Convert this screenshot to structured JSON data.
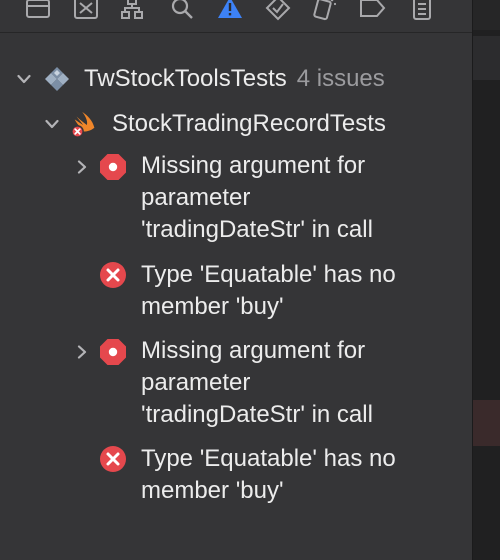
{
  "toolbar": {
    "icons": [
      "project-navigator-icon",
      "source-control-icon",
      "symbol-navigator-icon",
      "find-navigator-icon",
      "issue-navigator-icon",
      "test-navigator-icon",
      "debug-navigator-icon",
      "breakpoint-navigator-icon",
      "report-navigator-icon"
    ],
    "active_icon": "issue-navigator-icon",
    "active_color": "#3d82f6"
  },
  "tree": {
    "project": {
      "name": "TwStockToolsTests",
      "issue_count": "4 issues",
      "icon": "test-target-icon"
    },
    "file": {
      "name": "StockTradingRecordTests",
      "icon": "swift-file-error-icon"
    },
    "issues": [
      {
        "type": "error-octagon",
        "expandable": true,
        "lines": [
          "Missing argument for",
          "parameter",
          "'tradingDateStr' in call"
        ]
      },
      {
        "type": "error-circle",
        "expandable": false,
        "lines": [
          "Type 'Equatable' has no",
          "member 'buy'"
        ]
      },
      {
        "type": "error-octagon",
        "expandable": true,
        "lines": [
          "Missing argument for",
          "parameter",
          "'tradingDateStr' in call"
        ]
      },
      {
        "type": "error-circle",
        "expandable": false,
        "lines": [
          "Type 'Equatable' has no",
          "member 'buy'"
        ]
      }
    ]
  },
  "colors": {
    "error_red": "#e5484d",
    "navigator_bg": "#353537",
    "text_primary": "#ececec",
    "text_secondary": "#9b9b9e",
    "swift_orange": "#f0862a"
  }
}
